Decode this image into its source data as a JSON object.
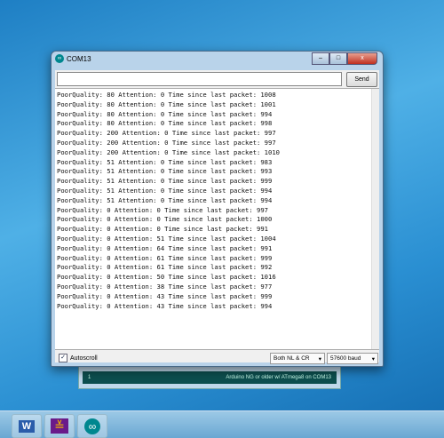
{
  "window": {
    "title": "COM13",
    "minimize": "–",
    "maximize": "□",
    "close": "x"
  },
  "send_label": "Send",
  "input_value": "",
  "output_lines": [
    "PoorQuality: 80 Attention: 0 Time since last packet: 1008",
    "PoorQuality: 80 Attention: 0 Time since last packet: 1001",
    "PoorQuality: 80 Attention: 0 Time since last packet: 994",
    "PoorQuality: 80 Attention: 0 Time since last packet: 998",
    "PoorQuality: 200 Attention: 0 Time since last packet: 997",
    "PoorQuality: 200 Attention: 0 Time since last packet: 997",
    "PoorQuality: 200 Attention: 0 Time since last packet: 1010",
    "PoorQuality: 51 Attention: 0 Time since last packet: 983",
    "PoorQuality: 51 Attention: 0 Time since last packet: 993",
    "PoorQuality: 51 Attention: 0 Time since last packet: 999",
    "PoorQuality: 51 Attention: 0 Time since last packet: 994",
    "PoorQuality: 51 Attention: 0 Time since last packet: 994",
    "PoorQuality: 0 Attention: 0 Time since last packet: 997",
    "PoorQuality: 0 Attention: 0 Time since last packet: 1000",
    "PoorQuality: 0 Attention: 0 Time since last packet: 991",
    "PoorQuality: 0 Attention: 51 Time since last packet: 1004",
    "PoorQuality: 0 Attention: 64 Time since last packet: 991",
    "PoorQuality: 0 Attention: 61 Time since last packet: 999",
    "PoorQuality: 0 Attention: 61 Time since last packet: 992",
    "PoorQuality: 0 Attention: 50 Time since last packet: 1016",
    "PoorQuality: 0 Attention: 38 Time since last packet: 977",
    "PoorQuality: 0 Attention: 43 Time since last packet: 999",
    "PoorQuality: 0 Attention: 43 Time since last packet: 994"
  ],
  "autoscroll": {
    "label": "Autoscroll",
    "checked": true,
    "mark": "✓"
  },
  "line_ending": "Both NL & CR",
  "baud": "57600 baud",
  "arduino_status": {
    "line": "1",
    "board": "Arduino NG or older w/ ATmega8 on COM13"
  },
  "taskbar": [
    {
      "name": "word",
      "glyph": "W"
    },
    {
      "name": "app",
      "glyph": "≚"
    },
    {
      "name": "arduino",
      "glyph": "∞"
    }
  ]
}
